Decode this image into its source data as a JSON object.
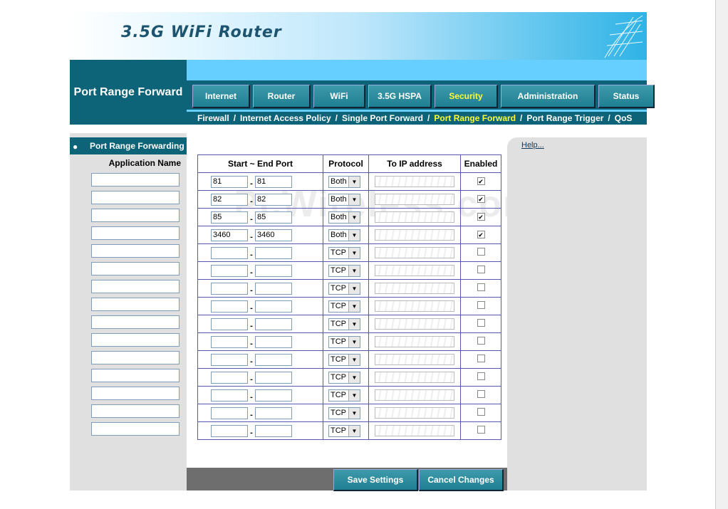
{
  "banner": {
    "title": "3.5G WiFi Router"
  },
  "section_title": "Port Range Forward",
  "nav": {
    "tabs": [
      {
        "label": "Internet",
        "active": false
      },
      {
        "label": "Router",
        "active": false
      },
      {
        "label": "WiFi",
        "active": false
      },
      {
        "label": "3.5G HSPA",
        "active": false
      },
      {
        "label": "Security",
        "active": true
      },
      {
        "label": "Administration",
        "active": false
      },
      {
        "label": "Status",
        "active": false
      }
    ],
    "subtabs": [
      {
        "label": "Firewall",
        "active": false
      },
      {
        "label": "Internet Access Policy",
        "active": false
      },
      {
        "label": "Single Port Forward",
        "active": false
      },
      {
        "label": "Port Range Forward",
        "active": true
      },
      {
        "label": "Port Range Trigger",
        "active": false
      },
      {
        "label": "QoS",
        "active": false
      }
    ],
    "separator": "/"
  },
  "sidebar": {
    "heading": "Port Range Forwarding",
    "bullet": "●"
  },
  "table": {
    "app_name_header": "Application Name",
    "headers": {
      "ports": "Start ~ End Port",
      "protocol": "Protocol",
      "ip": "To IP address",
      "enabled": "Enabled"
    },
    "dash": "-",
    "rows": [
      {
        "start": "81",
        "end": "81",
        "protocol": "Both",
        "enabled": true
      },
      {
        "start": "82",
        "end": "82",
        "protocol": "Both",
        "enabled": true
      },
      {
        "start": "85",
        "end": "85",
        "protocol": "Both",
        "enabled": true
      },
      {
        "start": "3460",
        "end": "3460",
        "protocol": "Both",
        "enabled": true
      },
      {
        "start": "",
        "end": "",
        "protocol": "TCP",
        "enabled": false
      },
      {
        "start": "",
        "end": "",
        "protocol": "TCP",
        "enabled": false
      },
      {
        "start": "",
        "end": "",
        "protocol": "TCP",
        "enabled": false
      },
      {
        "start": "",
        "end": "",
        "protocol": "TCP",
        "enabled": false
      },
      {
        "start": "",
        "end": "",
        "protocol": "TCP",
        "enabled": false
      },
      {
        "start": "",
        "end": "",
        "protocol": "TCP",
        "enabled": false
      },
      {
        "start": "",
        "end": "",
        "protocol": "TCP",
        "enabled": false
      },
      {
        "start": "",
        "end": "",
        "protocol": "TCP",
        "enabled": false
      },
      {
        "start": "",
        "end": "",
        "protocol": "TCP",
        "enabled": false
      },
      {
        "start": "",
        "end": "",
        "protocol": "TCP",
        "enabled": false
      },
      {
        "start": "",
        "end": "",
        "protocol": "TCP",
        "enabled": false
      }
    ]
  },
  "help": {
    "label": "Help..."
  },
  "buttons": {
    "save": "Save Settings",
    "cancel": "Cancel Changes"
  },
  "watermark": "PcWireless.com",
  "colors": {
    "dark_teal": "#0d6378",
    "light_blue": "#66cfff",
    "active_text": "#ffff33",
    "grid_border": "#5959b3"
  },
  "icons": {
    "dropdown": "chevron-down-icon",
    "dish": "satellite-dish-icon",
    "check": "checkmark-icon"
  }
}
